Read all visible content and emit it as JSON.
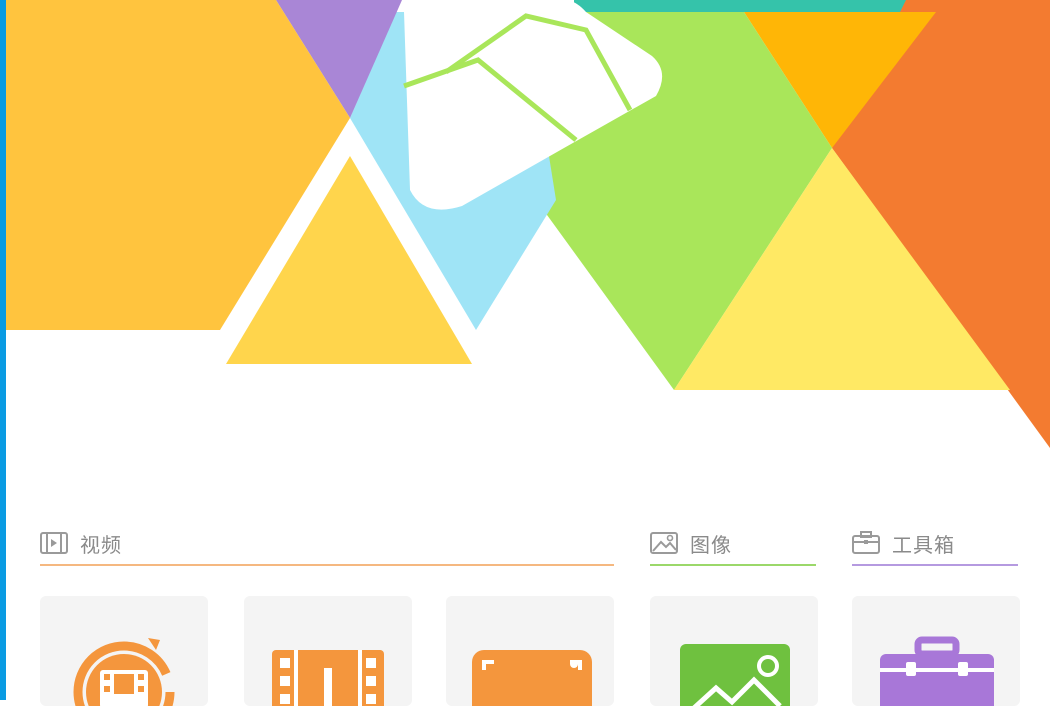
{
  "sections": {
    "video": {
      "label": "视频",
      "icon": "film-strip-icon"
    },
    "image": {
      "label": "图像",
      "icon": "picture-icon"
    },
    "tools": {
      "label": "工具箱",
      "icon": "toolbox-icon"
    }
  },
  "cards": [
    {
      "icon": "video-convert-icon",
      "color": "#f4963d"
    },
    {
      "icon": "video-cut-icon",
      "color": "#f4963d"
    },
    {
      "icon": "screen-record-icon",
      "color": "#f4963d"
    },
    {
      "icon": "image-edit-icon",
      "color": "#6fc13f"
    },
    {
      "icon": "toolbox-icon",
      "color": "#a877d8"
    }
  ],
  "colors": {
    "edge": "#0a9be3",
    "video_accent": "#f4963d",
    "image_accent": "#6fc13f",
    "tools_accent": "#a877d8"
  }
}
